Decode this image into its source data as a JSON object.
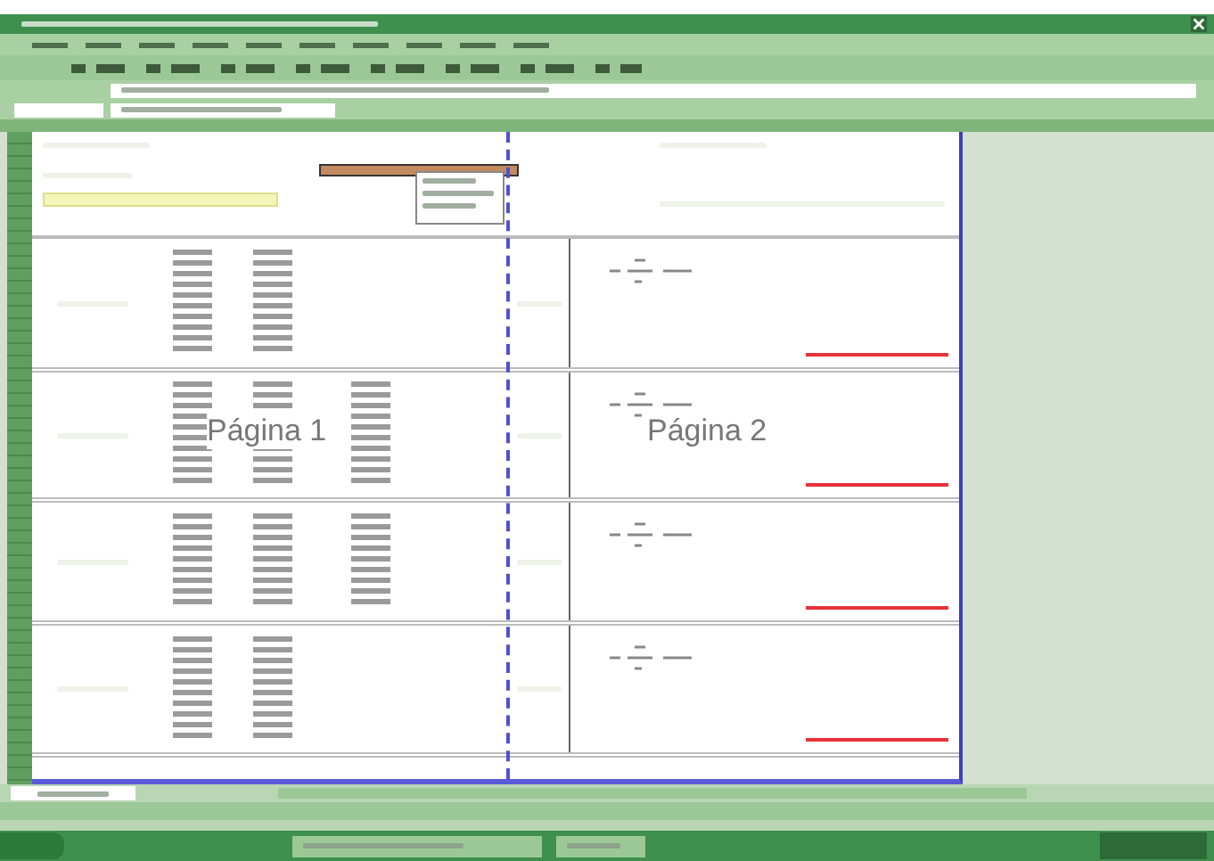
{
  "sheet": {
    "page_labels": [
      "Página 1",
      "Página 2"
    ]
  }
}
